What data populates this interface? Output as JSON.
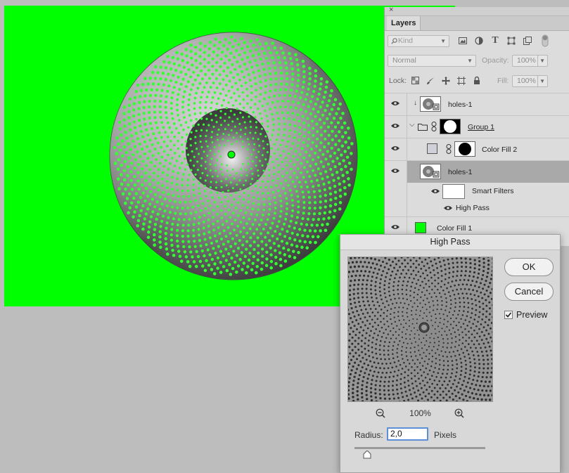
{
  "canvas": {
    "background_color": "#00ff00",
    "hole_color": "#33ff33"
  },
  "layers_panel": {
    "close_glyph": "×",
    "tab_label": "Layers",
    "filter": {
      "kind_label": "Kind",
      "search_icon": "search-icon"
    },
    "blend_mode": "Normal",
    "opacity_label": "Opacity:",
    "opacity_value": "100%",
    "lock_label": "Lock:",
    "fill_label": "Fill:",
    "fill_value": "100%",
    "layers": [
      {
        "name": "holes-1"
      },
      {
        "name": "Group 1"
      },
      {
        "name": "Color Fill 2"
      },
      {
        "name": "holes-1"
      },
      {
        "name": "Smart Filters"
      },
      {
        "name": "High Pass"
      },
      {
        "name": "Color Fill 1"
      }
    ],
    "accent_green": "#00ff00"
  },
  "high_pass": {
    "title": "High Pass",
    "ok_label": "OK",
    "cancel_label": "Cancel",
    "preview_label": "Preview",
    "preview_checked": true,
    "zoom": "100%",
    "radius_label": "Radius:",
    "radius_value": "2,0",
    "units_label": "Pixels"
  }
}
